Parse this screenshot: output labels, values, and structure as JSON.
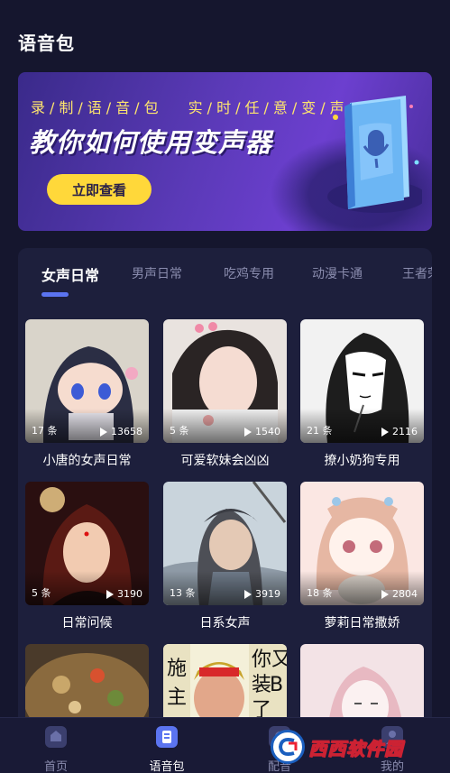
{
  "header": {
    "title": "语音包"
  },
  "banner": {
    "subtitle_left": "录/制/语/音/包",
    "subtitle_right": "实/时/任/意/变/声",
    "title": "教你如何使用变声器",
    "button_label": "立即查看"
  },
  "tabs": [
    {
      "label": "女声日常",
      "active": true
    },
    {
      "label": "男声日常",
      "active": false
    },
    {
      "label": "吃鸡专用",
      "active": false
    },
    {
      "label": "动漫卡通",
      "active": false
    },
    {
      "label": "王者荣",
      "active": false
    }
  ],
  "cards": [
    {
      "count": "17 条",
      "plays": "13658",
      "title": "小唐的女声日常"
    },
    {
      "count": "5 条",
      "plays": "1540",
      "title": "可爱软妹会凶凶"
    },
    {
      "count": "21 条",
      "plays": "2116",
      "title": "撩小奶狗专用"
    },
    {
      "count": "5 条",
      "plays": "3190",
      "title": "日常问候"
    },
    {
      "count": "13 条",
      "plays": "3919",
      "title": "日系女声"
    },
    {
      "count": "18 条",
      "plays": "2804",
      "title": "萝莉日常撒娇"
    },
    {
      "count": "",
      "plays": "",
      "title": ""
    },
    {
      "count": "",
      "plays": "",
      "title": ""
    },
    {
      "count": "",
      "plays": "",
      "title": ""
    }
  ],
  "nav": [
    {
      "label": "首页",
      "icon": "home-icon",
      "active": false
    },
    {
      "label": "语音包",
      "icon": "voice-pack-icon",
      "active": true
    },
    {
      "label": "配音",
      "icon": "dubbing-icon",
      "active": false
    },
    {
      "label": "我的",
      "icon": "profile-icon",
      "active": false
    }
  ],
  "watermark": {
    "text": "西西软件园"
  },
  "colors": {
    "background": "#15162e",
    "panel": "#1d1f3c",
    "accent": "#5b74f0",
    "banner_button": "#ffd83a",
    "banner_subtitle": "#ffe66d"
  }
}
